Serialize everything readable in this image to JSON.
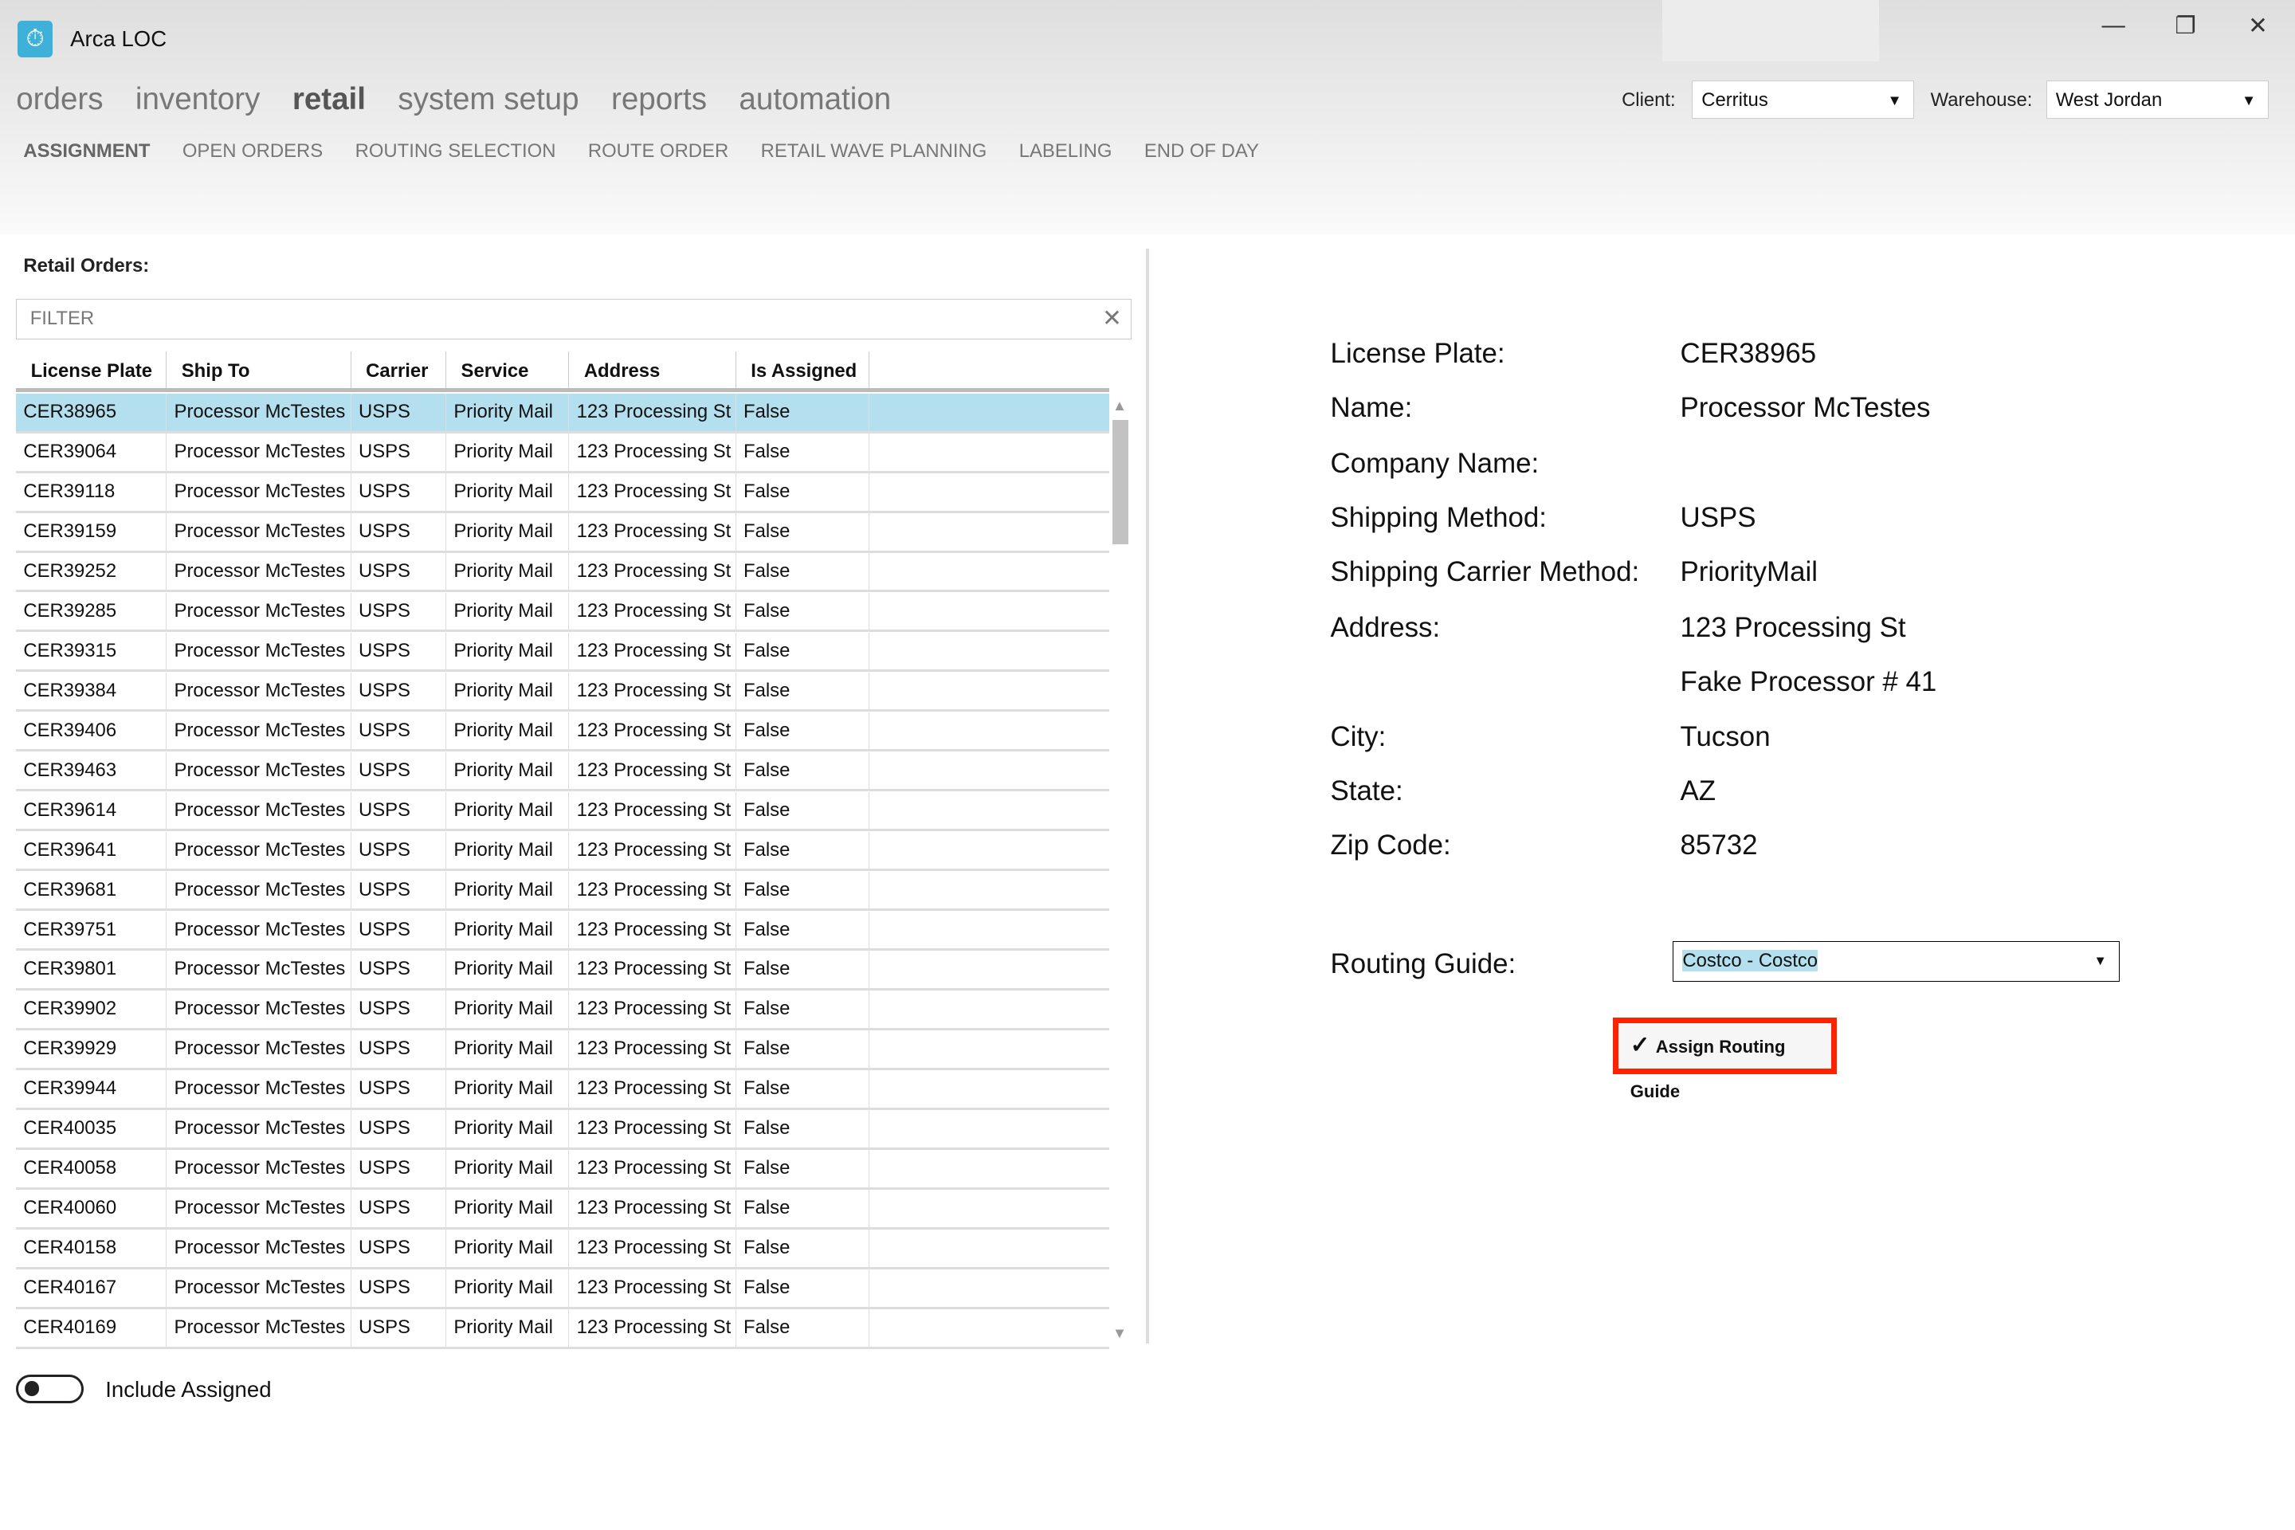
{
  "app": {
    "title": "Arca LOC",
    "logo_icon": "stopwatch-icon"
  },
  "window": {
    "minimize": "—",
    "restore": "❐",
    "close": "✕"
  },
  "nav": {
    "items": [
      "orders",
      "inventory",
      "retail",
      "system setup",
      "reports",
      "automation"
    ],
    "active": "retail"
  },
  "subnav": {
    "items": [
      "ASSIGNMENT",
      "OPEN ORDERS",
      "ROUTING SELECTION",
      "ROUTE ORDER",
      "RETAIL WAVE PLANNING",
      "LABELING",
      "END OF DAY"
    ],
    "active": "ASSIGNMENT"
  },
  "client": {
    "label": "Client:",
    "value": "Cerritus"
  },
  "warehouse": {
    "label": "Warehouse:",
    "value": "West Jordan"
  },
  "orders": {
    "title": "Retail Orders:",
    "filter_placeholder": "FILTER",
    "columns": [
      "License Plate",
      "Ship To",
      "Carrier",
      "Service",
      "Address",
      "Is Assigned"
    ],
    "selected_index": 0,
    "rows": [
      [
        "CER38965",
        "Processor McTestes",
        "USPS",
        "Priority Mail",
        "123 Processing St",
        "False"
      ],
      [
        "CER39064",
        "Processor McTestes",
        "USPS",
        "Priority Mail",
        "123 Processing St",
        "False"
      ],
      [
        "CER39118",
        "Processor McTestes",
        "USPS",
        "Priority Mail",
        "123 Processing St",
        "False"
      ],
      [
        "CER39159",
        "Processor McTestes",
        "USPS",
        "Priority Mail",
        "123 Processing St",
        "False"
      ],
      [
        "CER39252",
        "Processor McTestes",
        "USPS",
        "Priority Mail",
        "123 Processing St",
        "False"
      ],
      [
        "CER39285",
        "Processor McTestes",
        "USPS",
        "Priority Mail",
        "123 Processing St",
        "False"
      ],
      [
        "CER39315",
        "Processor McTestes",
        "USPS",
        "Priority Mail",
        "123 Processing St",
        "False"
      ],
      [
        "CER39384",
        "Processor McTestes",
        "USPS",
        "Priority Mail",
        "123 Processing St",
        "False"
      ],
      [
        "CER39406",
        "Processor McTestes",
        "USPS",
        "Priority Mail",
        "123 Processing St",
        "False"
      ],
      [
        "CER39463",
        "Processor McTestes",
        "USPS",
        "Priority Mail",
        "123 Processing St",
        "False"
      ],
      [
        "CER39614",
        "Processor McTestes",
        "USPS",
        "Priority Mail",
        "123 Processing St",
        "False"
      ],
      [
        "CER39641",
        "Processor McTestes",
        "USPS",
        "Priority Mail",
        "123 Processing St",
        "False"
      ],
      [
        "CER39681",
        "Processor McTestes",
        "USPS",
        "Priority Mail",
        "123 Processing St",
        "False"
      ],
      [
        "CER39751",
        "Processor McTestes",
        "USPS",
        "Priority Mail",
        "123 Processing St",
        "False"
      ],
      [
        "CER39801",
        "Processor McTestes",
        "USPS",
        "Priority Mail",
        "123 Processing St",
        "False"
      ],
      [
        "CER39902",
        "Processor McTestes",
        "USPS",
        "Priority Mail",
        "123 Processing St",
        "False"
      ],
      [
        "CER39929",
        "Processor McTestes",
        "USPS",
        "Priority Mail",
        "123 Processing St",
        "False"
      ],
      [
        "CER39944",
        "Processor McTestes",
        "USPS",
        "Priority Mail",
        "123 Processing St",
        "False"
      ],
      [
        "CER40035",
        "Processor McTestes",
        "USPS",
        "Priority Mail",
        "123 Processing St",
        "False"
      ],
      [
        "CER40058",
        "Processor McTestes",
        "USPS",
        "Priority Mail",
        "123 Processing St",
        "False"
      ],
      [
        "CER40060",
        "Processor McTestes",
        "USPS",
        "Priority Mail",
        "123 Processing St",
        "False"
      ],
      [
        "CER40158",
        "Processor McTestes",
        "USPS",
        "Priority Mail",
        "123 Processing St",
        "False"
      ],
      [
        "CER40167",
        "Processor McTestes",
        "USPS",
        "Priority Mail",
        "123 Processing St",
        "False"
      ],
      [
        "CER40169",
        "Processor McTestes",
        "USPS",
        "Priority Mail",
        "123 Processing St",
        "False"
      ]
    ],
    "include_assigned": {
      "label": "Include Assigned",
      "on": false
    }
  },
  "details": {
    "fields": [
      {
        "label": "License Plate:",
        "value": "CER38965"
      },
      {
        "label": "Name:",
        "value": "Processor McTestes"
      },
      {
        "label": "Company Name:",
        "value": ""
      },
      {
        "label": "Shipping Method:",
        "value": "USPS"
      },
      {
        "label": "Shipping Carrier Method:",
        "value": "PriorityMail"
      },
      {
        "label": "Address:",
        "value": "123 Processing St"
      },
      {
        "label": "",
        "value": "Fake Processor # 41"
      },
      {
        "label": "City:",
        "value": "Tucson"
      },
      {
        "label": "State:",
        "value": "AZ"
      },
      {
        "label": "Zip Code:",
        "value": "85732"
      }
    ],
    "routing_label": "Routing Guide:",
    "routing_value": "Costco - Costco",
    "assign_button": "Assign Routing Guide",
    "highlight_color": "#ff2200",
    "selection_color": "#b3dfee"
  }
}
